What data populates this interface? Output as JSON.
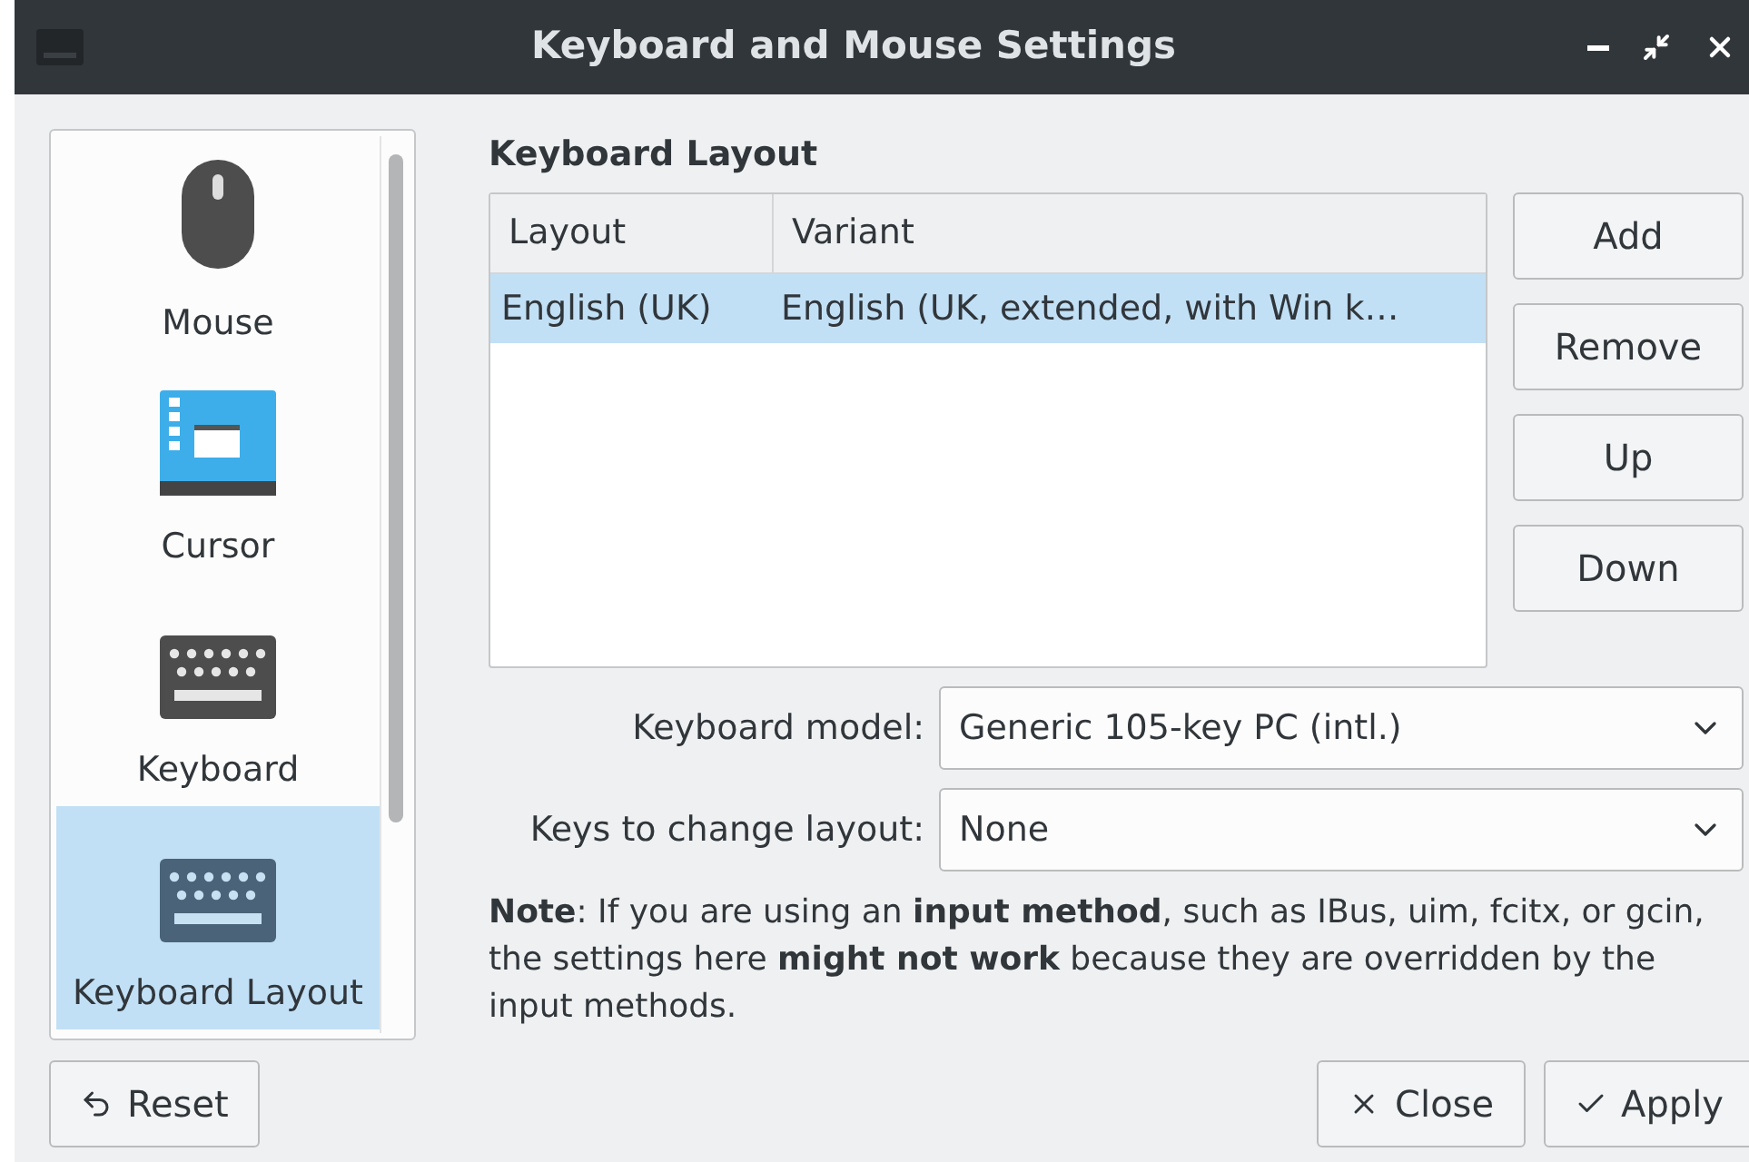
{
  "window": {
    "title": "Keyboard and Mouse Settings"
  },
  "sidebar": {
    "items": [
      {
        "label": "Mouse",
        "kind": "mouse",
        "selected": false
      },
      {
        "label": "Cursor",
        "kind": "cursor",
        "selected": false
      },
      {
        "label": "Keyboard",
        "kind": "keyboard",
        "selected": false
      },
      {
        "label": "Keyboard Layout",
        "kind": "keyboard",
        "selected": true
      }
    ]
  },
  "section_title": "Keyboard Layout",
  "table": {
    "columns": [
      "Layout",
      "Variant"
    ],
    "rows": [
      {
        "cells": [
          "English (UK)",
          "English (UK, extended, with Win k…"
        ],
        "selected": true
      }
    ]
  },
  "side_buttons": [
    "Add",
    "Remove",
    "Up",
    "Down"
  ],
  "fields": [
    {
      "label": "Keyboard model:",
      "value": "Generic 105-key PC (intl.)"
    },
    {
      "label": "Keys to change layout:",
      "value": "None"
    }
  ],
  "note": "**Note**: If you are using an **input method**, such as IBus, uim, fcitx, or gcin, the settings here **might not work** because they are overridden by the input methods.",
  "footer": {
    "left": [
      {
        "label": "Reset",
        "kind": "reset"
      }
    ],
    "right": [
      {
        "label": "Close",
        "kind": "close"
      },
      {
        "label": "Apply",
        "kind": "apply"
      }
    ]
  }
}
